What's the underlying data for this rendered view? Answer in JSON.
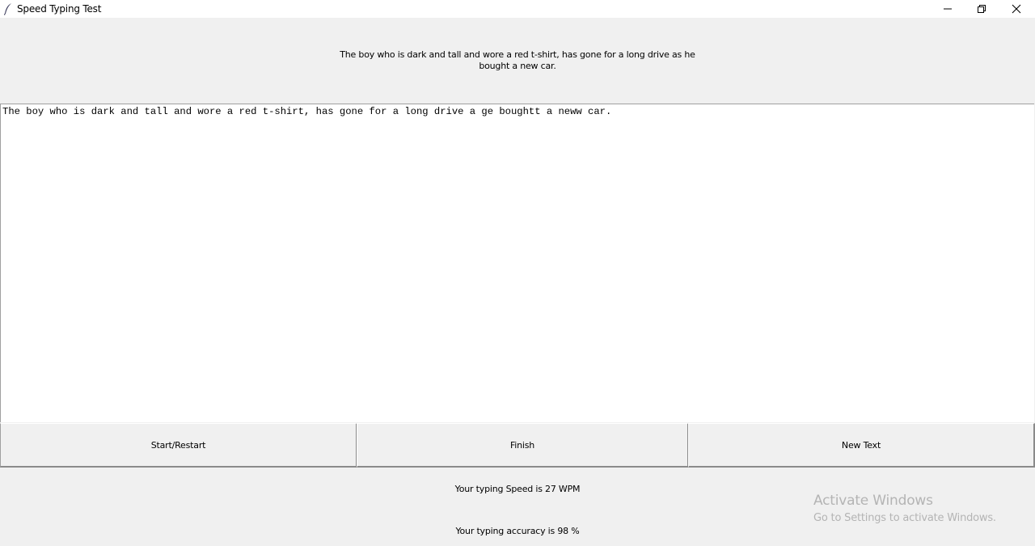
{
  "window": {
    "title": "Speed Typing Test",
    "icons": {
      "app": "feather-icon",
      "minimize": "minimize-icon",
      "maximize": "restore-icon",
      "close": "close-icon"
    }
  },
  "sentence": "The boy who is dark and tall and wore a red t-shirt, has gone for a long drive as he bought a new car.",
  "entry": {
    "value": "The boy who is dark and tall and wore a red t-shirt, has gone for a long drive a ge boughtt a neww car."
  },
  "buttons": {
    "start": "Start/Restart",
    "finish": "Finish",
    "new_text": "New Text"
  },
  "results": {
    "speed": "Your typing Speed is 27 WPM",
    "accuracy": "Your typing accuracy is 98 %"
  },
  "watermark": {
    "title": "Activate Windows",
    "subtitle": "Go to Settings to activate Windows."
  },
  "colors": {
    "window_bg": "#f0f0f0",
    "entry_bg": "#ffffff",
    "watermark": "#b4b4b4"
  }
}
